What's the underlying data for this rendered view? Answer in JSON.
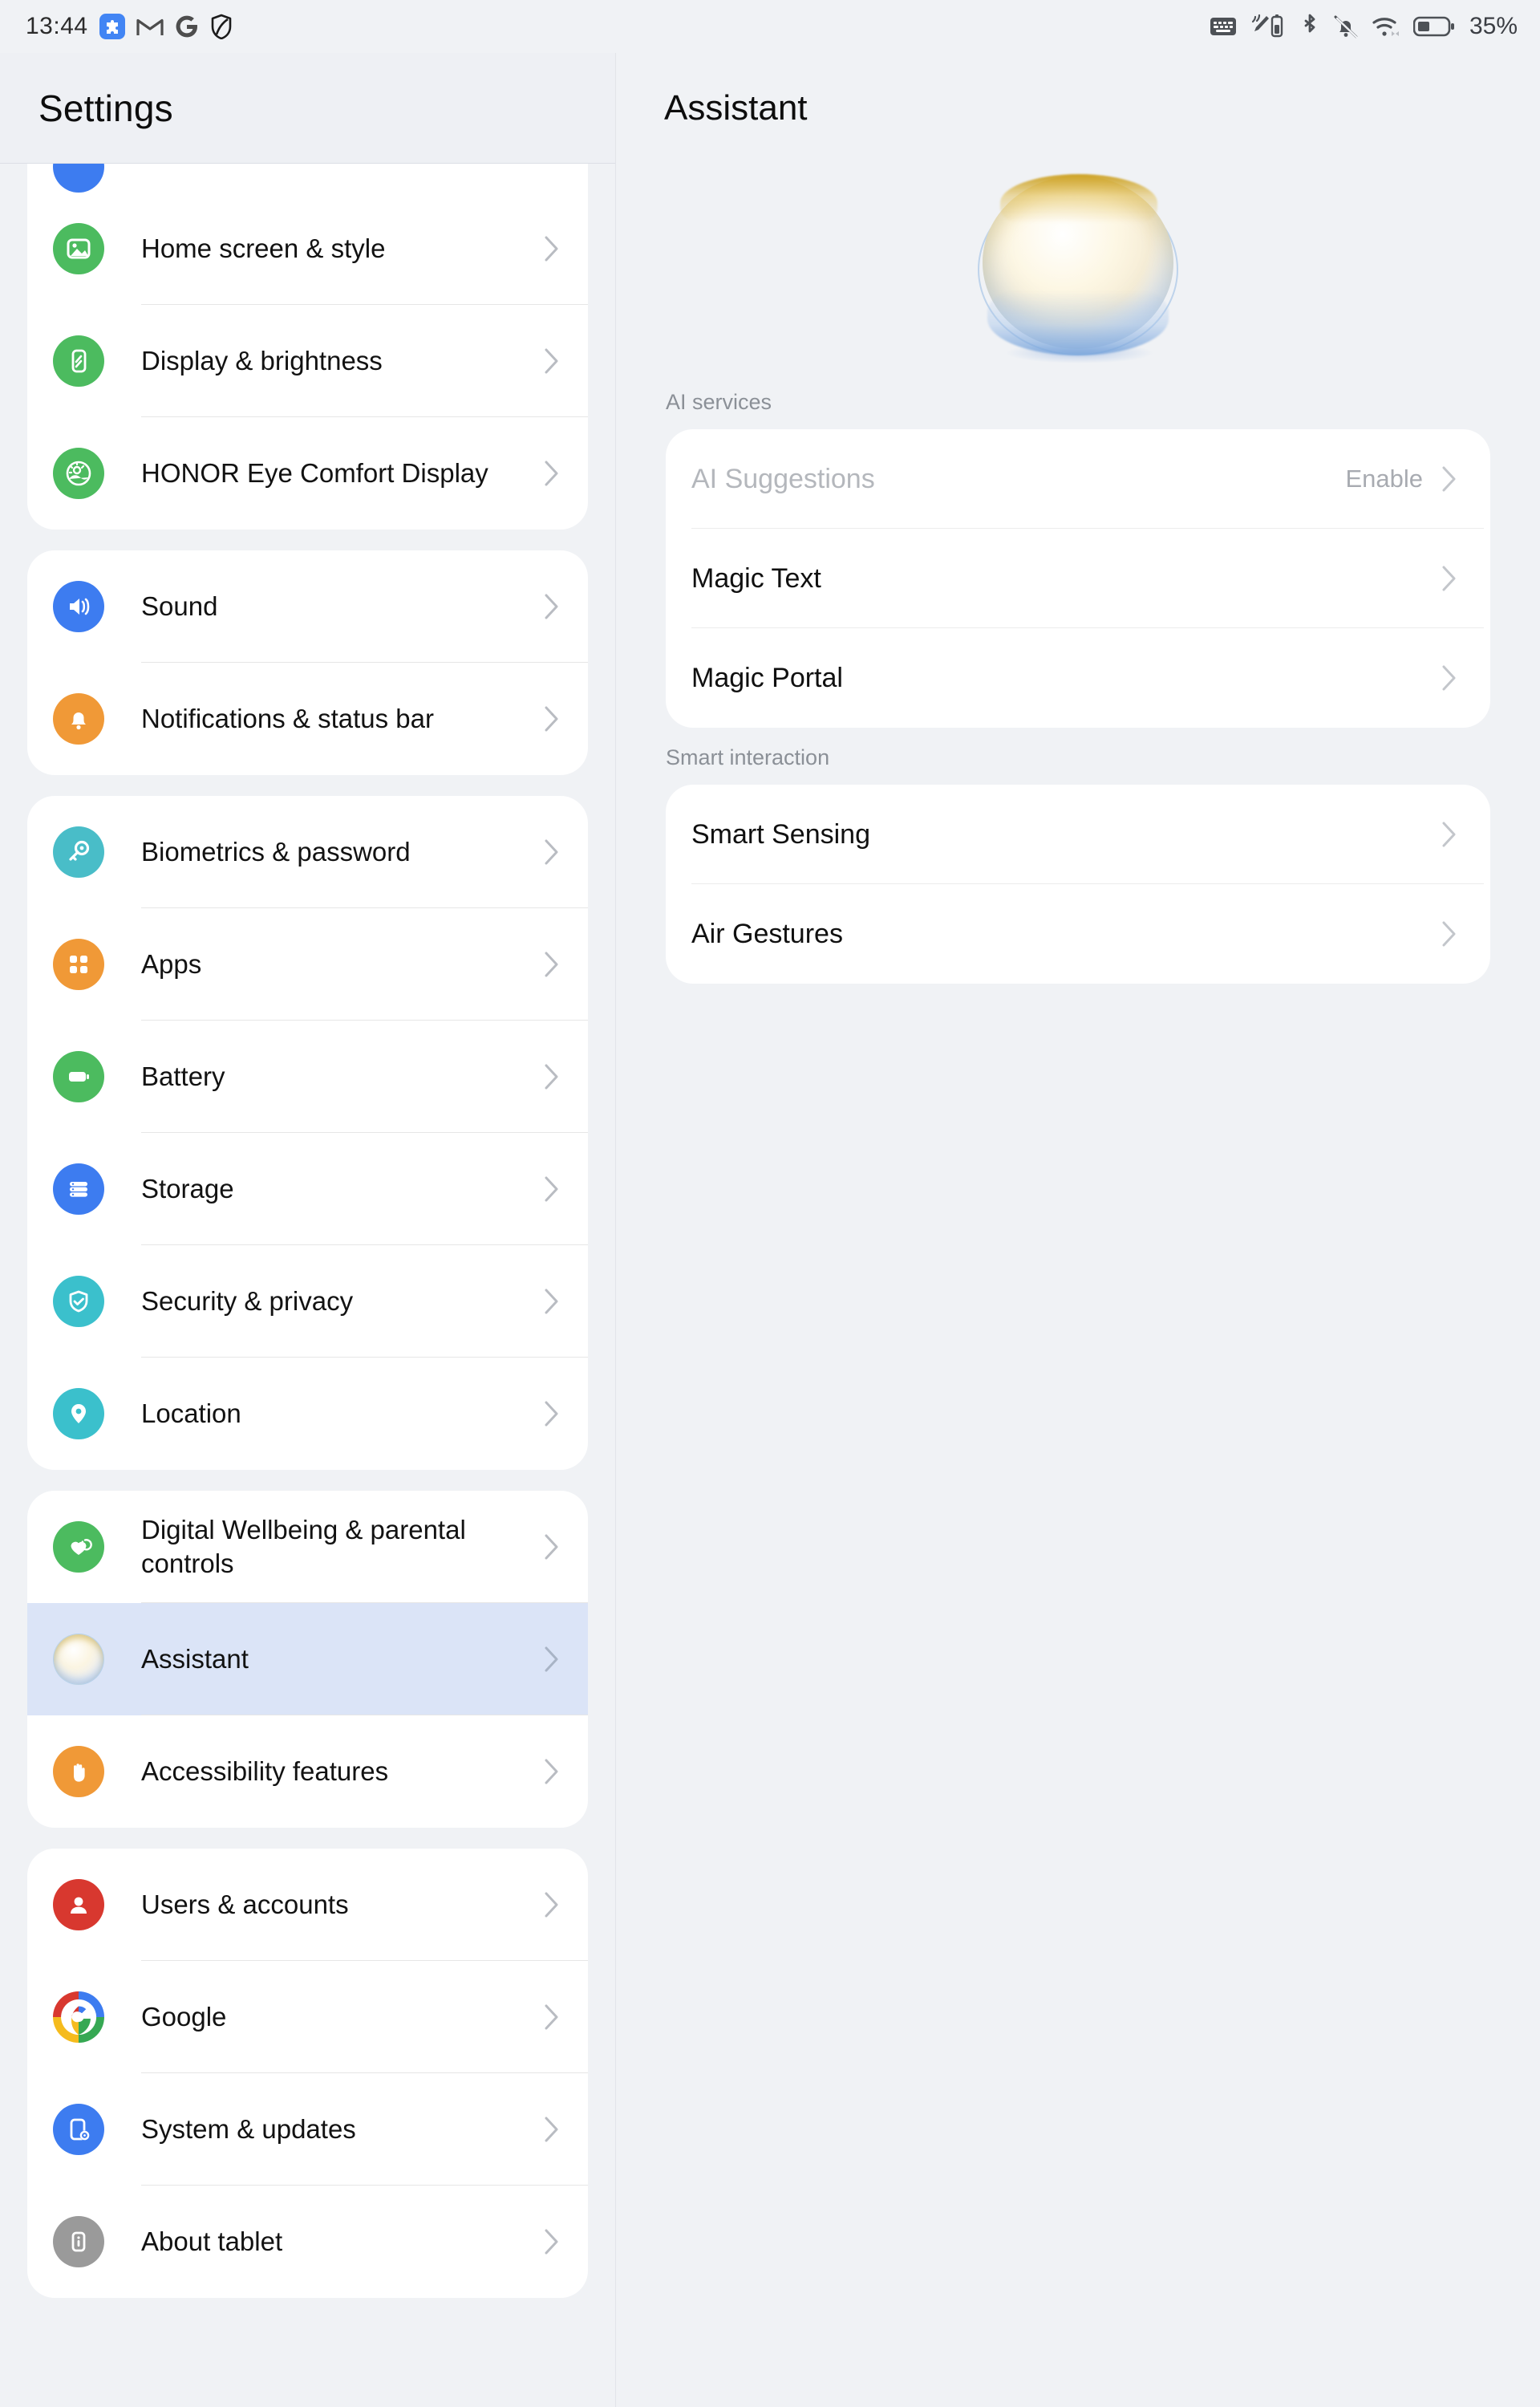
{
  "statusbar": {
    "time": "13:44",
    "left_icons": [
      "puzzle-extension-icon",
      "gmail-icon",
      "google-icon",
      "shield-icon"
    ],
    "right_icons": [
      "keyboard-icon",
      "stylus-battery-icon",
      "bluetooth-icon",
      "notifications-muted-icon",
      "wifi-icon",
      "battery-icon"
    ],
    "battery_percent": "35%"
  },
  "sidebar": {
    "title": "Settings",
    "groups": [
      {
        "partial_top_item": true,
        "items": [
          {
            "label": "Home screen & style",
            "icon": "picture-icon",
            "color": "#4cbb5f",
            "selected": false
          },
          {
            "label": "Display & brightness",
            "icon": "brightness-phone-icon",
            "color": "#4cbb5f",
            "selected": false
          },
          {
            "label": "HONOR Eye Comfort Display",
            "icon": "eye-comfort-icon",
            "color": "#4cbb5f",
            "selected": false
          }
        ]
      },
      {
        "items": [
          {
            "label": "Sound",
            "icon": "speaker-icon",
            "color": "#3d7cf0",
            "selected": false
          },
          {
            "label": "Notifications & status bar",
            "icon": "bell-icon",
            "color": "#f09937",
            "selected": false
          }
        ]
      },
      {
        "items": [
          {
            "label": "Biometrics & password",
            "icon": "key-icon",
            "color": "#49bdc8",
            "selected": false
          },
          {
            "label": "Apps",
            "icon": "grid-squares-icon",
            "color": "#f09937",
            "selected": false
          },
          {
            "label": "Battery",
            "icon": "battery-icon",
            "color": "#4cbb5f",
            "selected": false
          },
          {
            "label": "Storage",
            "icon": "storage-stack-icon",
            "color": "#3d7cf0",
            "selected": false
          },
          {
            "label": "Security & privacy",
            "icon": "shield-check-icon",
            "color": "#3bc0cc",
            "selected": false
          },
          {
            "label": "Location",
            "icon": "location-pin-icon",
            "color": "#3bc0cc",
            "selected": false
          }
        ]
      },
      {
        "items": [
          {
            "label": "Digital Wellbeing & parental controls",
            "icon": "heart-wellbeing-icon",
            "color": "#4cbb5f",
            "selected": false
          },
          {
            "label": "Assistant",
            "icon": "assistant-pearl-icon",
            "color": "pearl",
            "selected": true
          },
          {
            "label": "Accessibility features",
            "icon": "hand-icon",
            "color": "#f09937",
            "selected": false
          }
        ]
      },
      {
        "items": [
          {
            "label": "Users & accounts",
            "icon": "person-icon",
            "color": "#d8382f",
            "selected": false
          },
          {
            "label": "Google",
            "icon": "google-g-icon",
            "color": "multicolor",
            "selected": false
          },
          {
            "label": "System & updates",
            "icon": "system-update-icon",
            "color": "#3d7cf0",
            "selected": false
          },
          {
            "label": "About tablet",
            "icon": "info-tablet-icon",
            "color": "#9a9a9a",
            "selected": false
          }
        ]
      }
    ]
  },
  "detail": {
    "title": "Assistant",
    "hero_icon": "assistant-pearl-hero",
    "sections": [
      {
        "heading": "AI services",
        "items": [
          {
            "label": "AI Suggestions",
            "value": "Enable",
            "disabled": true
          },
          {
            "label": "Magic Text",
            "value": "",
            "disabled": false
          },
          {
            "label": "Magic Portal",
            "value": "",
            "disabled": false
          }
        ]
      },
      {
        "heading": "Smart interaction",
        "items": [
          {
            "label": "Smart Sensing",
            "value": "",
            "disabled": false
          },
          {
            "label": "Air Gestures",
            "value": "",
            "disabled": false
          }
        ]
      }
    ]
  },
  "colors": {
    "background": "#f0f2f5",
    "card": "#ffffff",
    "selected_row": "#dbe4f7",
    "muted_text": "#8b9097"
  }
}
